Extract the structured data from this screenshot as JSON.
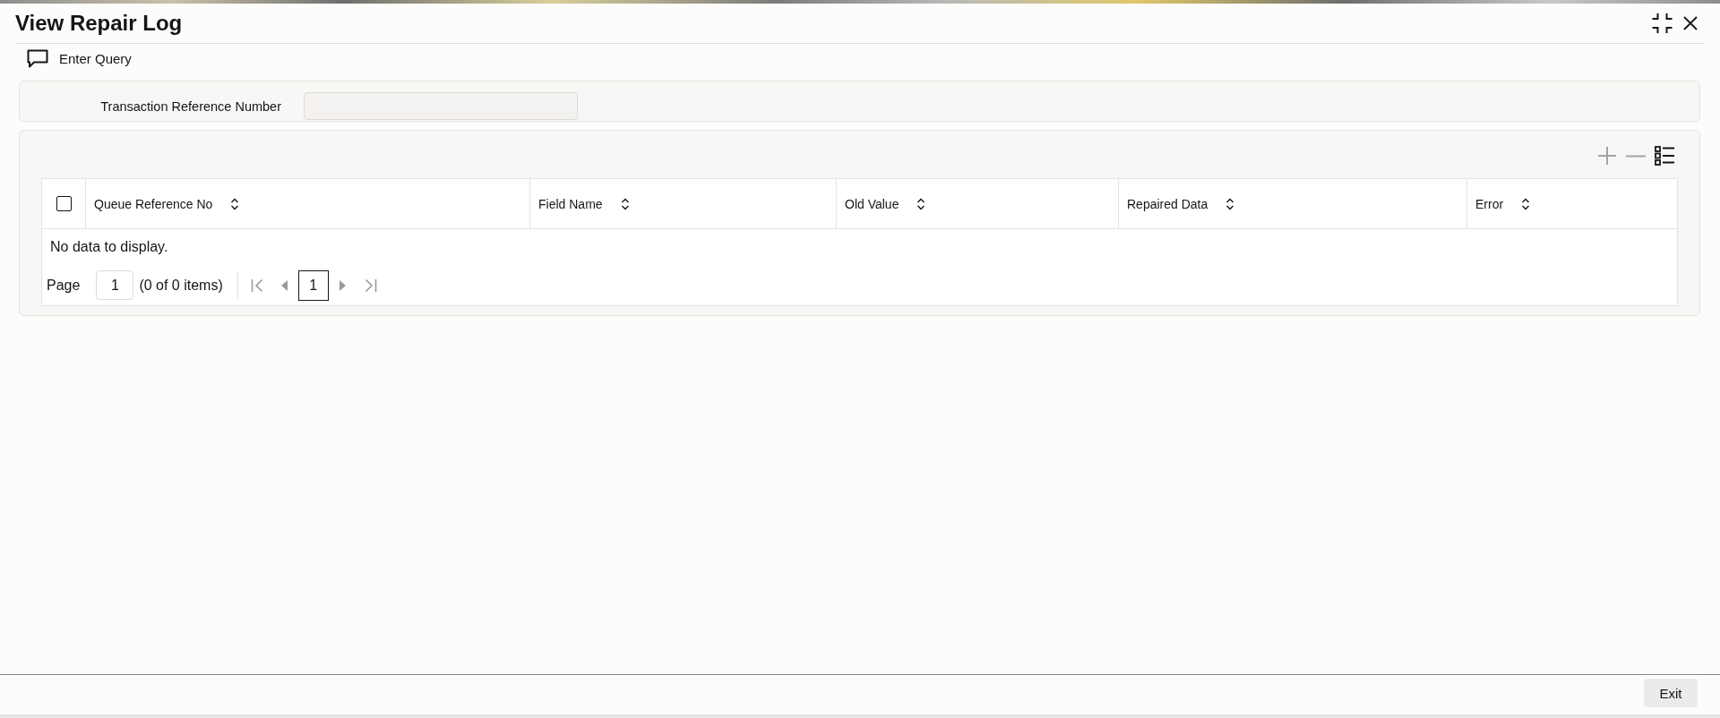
{
  "window": {
    "title": "View Repair Log"
  },
  "toolbar": {
    "enter_query": "Enter Query"
  },
  "query": {
    "fields": [
      {
        "label": "Transaction Reference Number"
      }
    ]
  },
  "table": {
    "actions": [
      {
        "kind": "add",
        "disabled": true
      },
      {
        "kind": "remove",
        "disabled": true
      },
      {
        "kind": "columns",
        "disabled": false
      }
    ],
    "select_all": {
      "checked": false
    },
    "columns": [
      {
        "label": "Queue Reference No"
      },
      {
        "label": "Field Name"
      },
      {
        "label": "Old Value"
      },
      {
        "label": "Repaired Data"
      },
      {
        "label": "Error"
      }
    ],
    "empty_message": "No data to display."
  },
  "pagination": {
    "page_label": "Page",
    "page_value": "1",
    "summary": "(0 of 0 items)",
    "controls": [
      {
        "kind": "first",
        "disabled": true
      },
      {
        "kind": "previous",
        "disabled": true
      },
      {
        "kind": "page",
        "label": "1",
        "selected": true
      },
      {
        "kind": "next",
        "disabled": true
      },
      {
        "kind": "last",
        "disabled": true
      }
    ]
  },
  "footer": {
    "buttons": [
      "Exit"
    ]
  }
}
